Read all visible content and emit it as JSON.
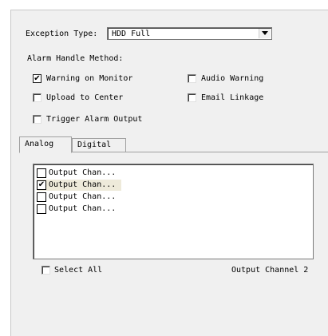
{
  "exception": {
    "label": "Exception Type:",
    "selected": "HDD Full"
  },
  "alarm_handle": {
    "label": "Alarm Handle Method:",
    "options": [
      {
        "label": "Warning on Monitor",
        "checked": true
      },
      {
        "label": "Audio Warning",
        "checked": false
      },
      {
        "label": "Upload to Center",
        "checked": false
      },
      {
        "label": "Email Linkage",
        "checked": false
      },
      {
        "label": "Trigger Alarm Output",
        "checked": false
      }
    ]
  },
  "tabs": [
    {
      "label": "Analog",
      "active": true
    },
    {
      "label": "Digital",
      "active": false
    }
  ],
  "output_list": {
    "items": [
      {
        "label": "Output Chan...",
        "checked": false,
        "selected": false
      },
      {
        "label": "Output Chan...",
        "checked": true,
        "selected": true
      },
      {
        "label": "Output Chan...",
        "checked": false,
        "selected": false
      },
      {
        "label": "Output Chan...",
        "checked": false,
        "selected": false
      }
    ]
  },
  "footer": {
    "select_all_label": "Select All",
    "select_all_checked": false,
    "status_text": "Output Channel 2"
  },
  "icons": {
    "check": "check-mark-icon",
    "dropdown": "chevron-down-icon"
  }
}
